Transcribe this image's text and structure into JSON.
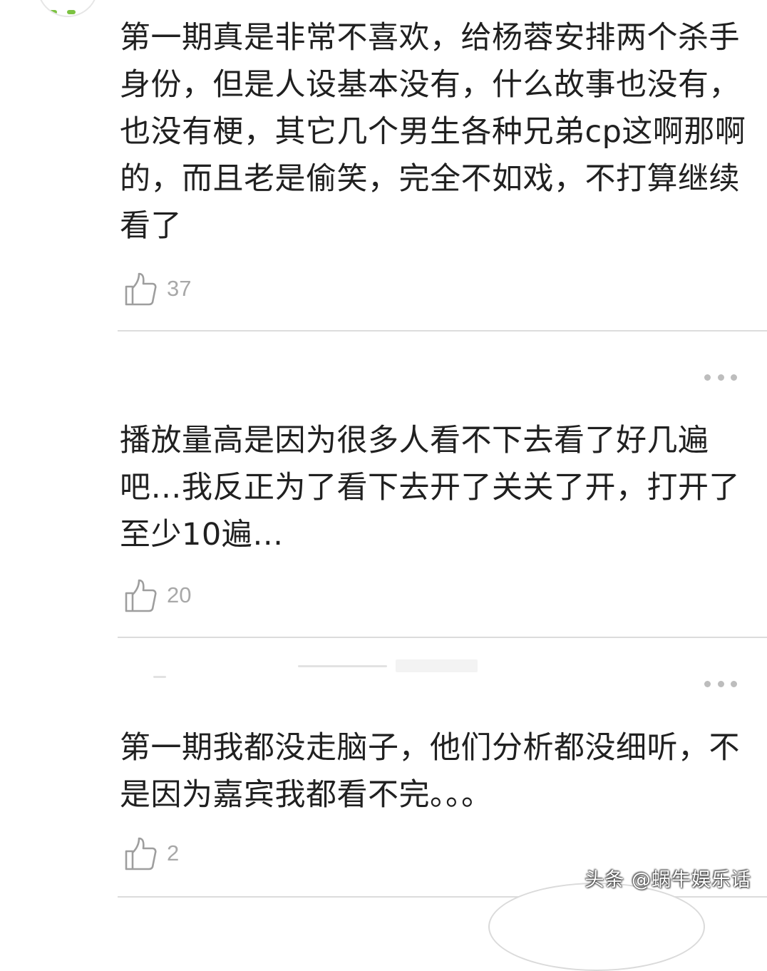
{
  "comments": [
    {
      "text": "第一期真是非常不喜欢，给杨蓉安排两个杀手身份，但是人设基本没有，什么故事也没有，也没有梗，其它几个男生各种兄弟cp这啊那啊的，而且老是偷笑，完全不如戏，不打算继续看了",
      "likes": "37"
    },
    {
      "text": "播放量高是因为很多人看不下去看了好几遍吧…我反正为了看下去开了关关了开，打开了至少10遍…",
      "likes": "20"
    },
    {
      "text": "第一期我都没走脑子，他们分析都没细听，不是因为嘉宾我都看不完。。。",
      "likes": "2"
    }
  ],
  "watermark": "头条 @蜗牛娱乐话",
  "icons": {
    "like": "thumbs-up-icon",
    "more": "more-dots-icon"
  },
  "colors": {
    "text": "#202020",
    "like_count": "#a8a8a8",
    "divider": "#dcdcdc",
    "more_dots": "#bdbdbd"
  }
}
